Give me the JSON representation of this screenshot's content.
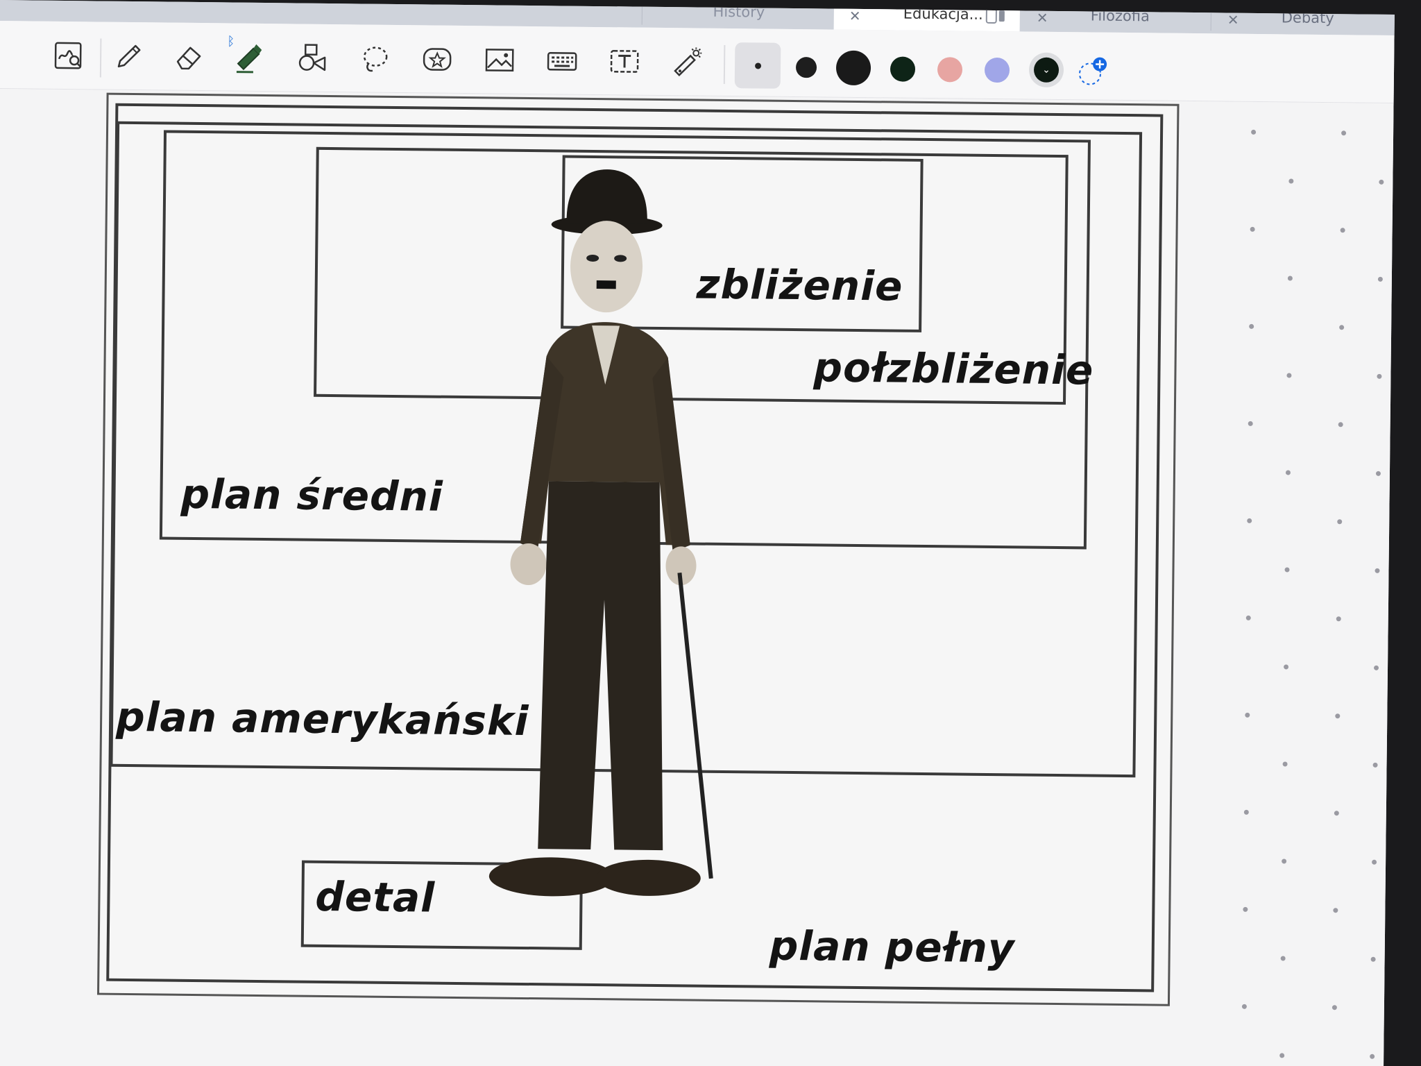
{
  "tabs": [
    {
      "label": "History",
      "active": false,
      "close": "✕"
    },
    {
      "label": "Edukacja...",
      "active": true,
      "close": "✕"
    },
    {
      "label": "Filozofia",
      "active": false,
      "close": "✕"
    },
    {
      "label": "Debaty",
      "active": false,
      "close": "✕"
    }
  ],
  "toolbar": {
    "tools": [
      "read-mode-icon",
      "pen-icon",
      "eraser-icon",
      "highlighter-icon",
      "shapes-icon",
      "lasso-icon",
      "sticker-icon",
      "image-icon",
      "keyboard-icon",
      "text-box-icon",
      "laser-pointer-icon"
    ],
    "highlighter_color": "#2e5e36",
    "bluetooth_color": "#1f6fd6",
    "swatches": [
      {
        "name": "black-dot-small",
        "color": "#222222"
      },
      {
        "name": "black-dot-medium",
        "color": "#1e1e1e"
      },
      {
        "name": "black-dot-large",
        "color": "#1a1a1a"
      },
      {
        "name": "dark-green",
        "color": "#0e2417"
      },
      {
        "name": "pink",
        "color": "#e7a5a2"
      },
      {
        "name": "periwinkle",
        "color": "#a0a6e8"
      },
      {
        "name": "selected-black",
        "color": "#0d1a12"
      }
    ],
    "add_color_accent": "#1668e3"
  },
  "diagram": {
    "labels": {
      "zblizenie": "zbliżenie",
      "polzblizenie": "połzbliżenie",
      "plan_sredni": "plan średni",
      "plan_amerykanski": "plan amerykański",
      "detal": "detal",
      "plan_pelny": "plan pełny"
    }
  }
}
